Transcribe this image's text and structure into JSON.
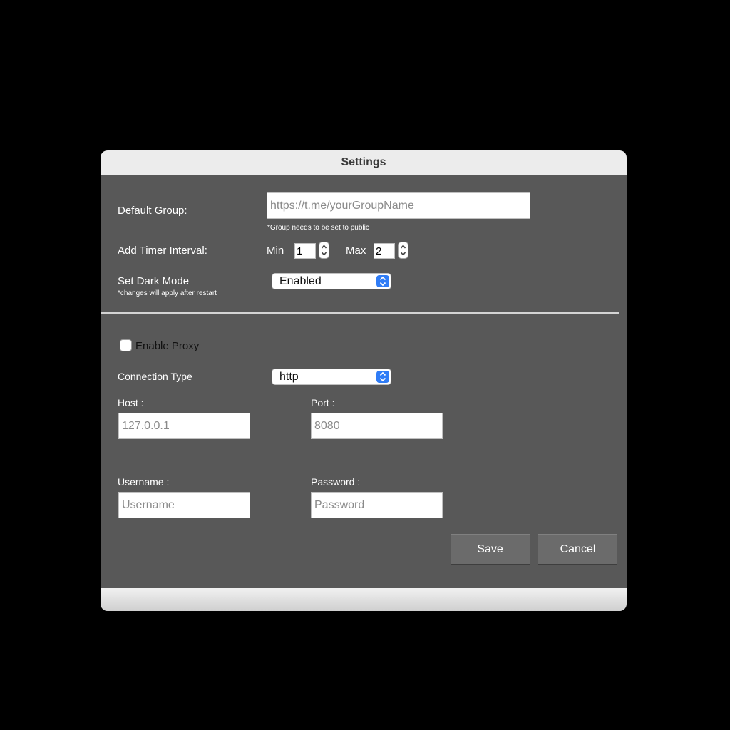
{
  "window": {
    "title": "Settings"
  },
  "general": {
    "default_group_label": "Default Group:",
    "default_group_placeholder": "https://t.me/yourGroupName",
    "group_note": "*Group needs to be set to public",
    "timer_label": "Add Timer Interval:",
    "min_label": "Min",
    "min_value": "1",
    "max_label": "Max",
    "max_value": "2",
    "dark_mode_label": "Set Dark Mode",
    "dark_mode_note": "*changes will apply after restart",
    "dark_mode_value": "Enabled"
  },
  "proxy": {
    "enable_label": "Enable Proxy",
    "enabled": false,
    "connection_type_label": "Connection Type",
    "connection_type_value": "http",
    "host_label": "Host :",
    "host_placeholder": "127.0.0.1",
    "port_label": "Port :",
    "port_placeholder": "8080",
    "username_label": "Username :",
    "username_placeholder": "Username",
    "password_label": "Password :",
    "password_placeholder": "Password"
  },
  "actions": {
    "save_label": "Save",
    "cancel_label": "Cancel"
  },
  "colors": {
    "accent": "#2f7cf6",
    "panel": "#585858",
    "titlebar": "#ececec"
  }
}
